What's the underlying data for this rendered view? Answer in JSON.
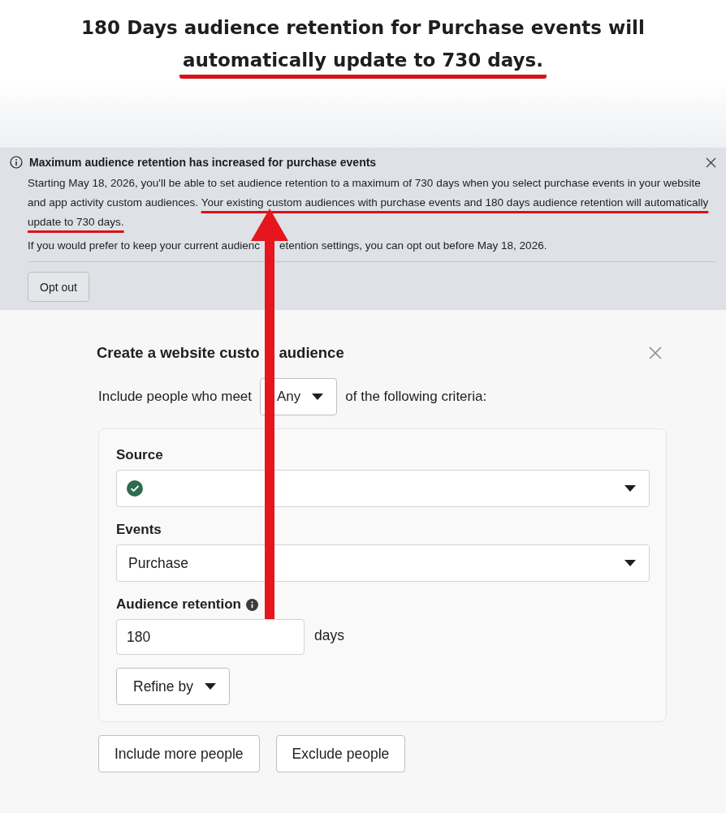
{
  "headline": {
    "line_1": "180 Days audience retention for Purchase events will",
    "line_2": "automatically update to 730 days."
  },
  "banner": {
    "title": "Maximum audience retention has increased for purchase events",
    "message": "Starting May 18, 2026, you'll be able to set audience retention to a maximum of 730 days when you select purchase events in your website and app activity custom audiences.",
    "highlight": "Your existing custom audiences with purchase events and 180 days audience retention will automatically update to 730 days.",
    "note_before": "If you would prefer to keep your current audienc",
    "note_after": "etention settings, you can opt out before May 18, 2026.",
    "button": "Opt out"
  },
  "dialog": {
    "title_before": "Create a website custo",
    "title_after": "audience",
    "include_prefix": "Include people who meet",
    "match": "Any",
    "include_suffix": "of the following criteria:",
    "source": {
      "label": "Source",
      "verified": true
    },
    "events": {
      "label": "Events",
      "value": "Purchase"
    },
    "retention": {
      "label": "Audience retention",
      "value": "180",
      "unit": "days"
    },
    "refine": "Refine by",
    "buttons": [
      "Include more people",
      "Exclude people"
    ]
  }
}
